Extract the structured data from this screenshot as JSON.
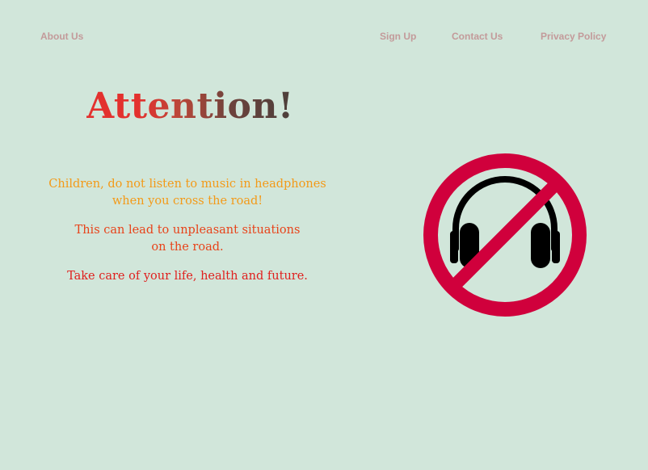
{
  "nav": {
    "about": "About Us",
    "signup": "Sign Up",
    "contact": "Contact Us",
    "privacy": "Privacy Policy"
  },
  "title": "Attention!",
  "messages": {
    "line1a": "Children, do not  listen to music in headphones",
    "line1b": "when you cross the road!",
    "line2a": "This can lead to unpleasant situations",
    "line2b": "on the road.",
    "line3": "Take care of your life, health and future."
  },
  "sign": {
    "icon": "no-headphones-icon",
    "ring_color": "#d0003c",
    "headphones_color": "#000000"
  },
  "colors": {
    "background": "#d1e6da",
    "nav_text": "#c39a9a",
    "line1": "#f39a18",
    "line2": "#e8431a",
    "line3": "#e0201e"
  }
}
